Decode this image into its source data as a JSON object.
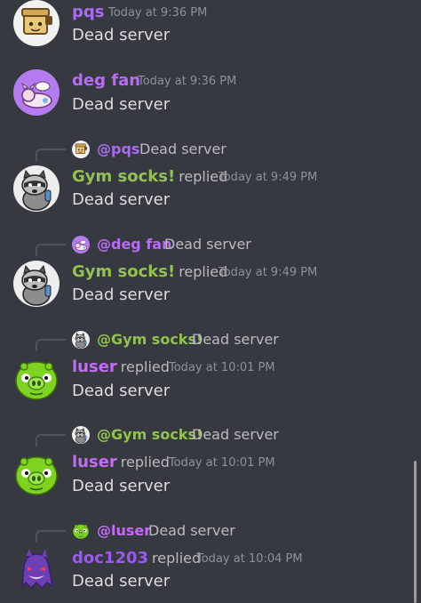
{
  "colors": {
    "background": "#36393f",
    "pqs": "#a86cf0",
    "deg_fan": "#b86bf5",
    "gym_socks": "#92c24f",
    "luser": "#c46bf5",
    "doc1203": "#9b59f2",
    "message_text": "#dcddde",
    "timestamp": "#8e9297"
  },
  "messages": [
    {
      "author": "pqs",
      "avatar_icon": "box-robot-avatar-icon",
      "timestamp": "Today at 9:36 PM",
      "content": "Dead server"
    },
    {
      "author": "deg fan",
      "avatar_icon": "purple-sleeping-creature-avatar-icon",
      "timestamp": "Today at 9:36 PM",
      "content": "Dead server"
    },
    {
      "author": "Gym socks!",
      "replied_label": "replied",
      "avatar_icon": "raccoon-avatar-icon",
      "timestamp": "Today at 9:49 PM",
      "content": "Dead server",
      "reply_to": {
        "mention": "@pqs",
        "text": "Dead server",
        "icon": "box-robot-mini-avatar-icon"
      }
    },
    {
      "author": "Gym socks!",
      "replied_label": "replied",
      "avatar_icon": "raccoon-avatar-icon",
      "timestamp": "Today at 9:49 PM",
      "content": "Dead server",
      "reply_to": {
        "mention": "@deg fan",
        "text": "Dead server",
        "icon": "purple-creature-mini-avatar-icon"
      }
    },
    {
      "author": "luser",
      "replied_label": "replied",
      "avatar_icon": "green-pig-avatar-icon",
      "timestamp": "Today at 10:01 PM",
      "content": "Dead server",
      "reply_to": {
        "mention": "@Gym socks!",
        "text": "Dead server",
        "icon": "raccoon-mini-avatar-icon"
      }
    },
    {
      "author": "luser",
      "replied_label": "replied",
      "avatar_icon": "green-pig-avatar-icon",
      "timestamp": "Today at 10:01 PM",
      "content": "Dead server",
      "reply_to": {
        "mention": "@Gym socks!",
        "text": "Dead server",
        "icon": "raccoon-mini-avatar-icon"
      }
    },
    {
      "author": "doc1203",
      "replied_label": "replied",
      "avatar_icon": "purple-ghost-avatar-icon",
      "timestamp": "Today at 10:04 PM",
      "content": "Dead server",
      "reply_to": {
        "mention": "@luser",
        "text": "Dead server",
        "icon": "green-pig-mini-avatar-icon"
      }
    }
  ]
}
